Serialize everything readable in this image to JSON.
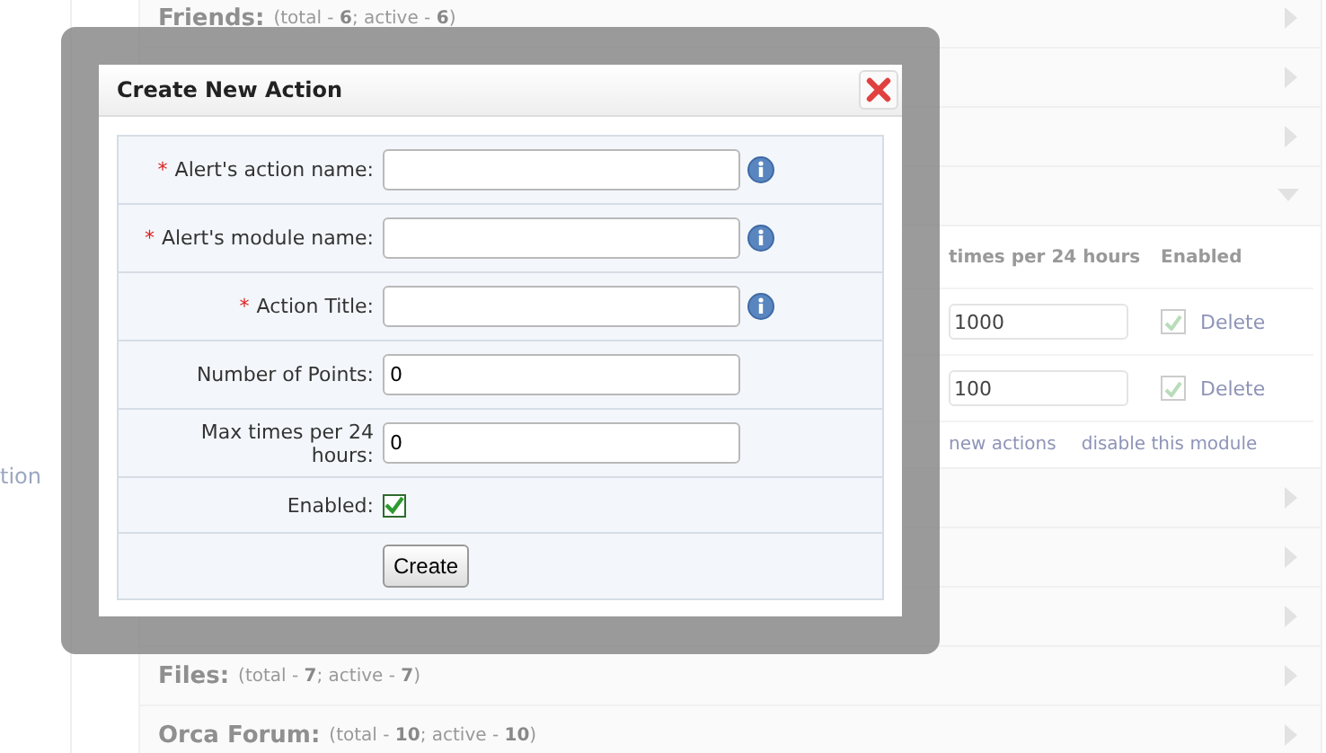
{
  "background": {
    "side_text": "tion",
    "modules": [
      {
        "title": "Friends:",
        "summary": "(total - **6**; active - **6**)",
        "expanded": false
      },
      {
        "expanded": false
      },
      {
        "expanded": false
      },
      {
        "expanded": true,
        "table": {
          "columns": [
            "times per 24 hours",
            "Enabled"
          ],
          "rows": [
            {
              "value": "1000",
              "enabled": true,
              "action": "Delete"
            },
            {
              "value": "100",
              "enabled": true,
              "action": "Delete"
            }
          ],
          "links": [
            "new actions",
            "disable this module"
          ]
        }
      },
      {
        "expanded": false
      },
      {
        "expanded": false
      },
      {
        "expanded": false
      },
      {
        "title": "Files:",
        "summary": "(total - **7**; active - **7**)",
        "expanded": false
      },
      {
        "title": "Orca Forum:",
        "summary": "(total - **10**; active - **10**)",
        "expanded": false
      }
    ]
  },
  "dialog": {
    "title": "Create New Action",
    "fields": [
      {
        "kind": "text",
        "required_mark": "*",
        "label": "Alert's action name:",
        "info": true
      },
      {
        "kind": "text",
        "required_mark": "*",
        "label": "Alert's module name:",
        "info": true
      },
      {
        "kind": "text",
        "required_mark": "*",
        "label": "Action Title:",
        "info": true
      },
      {
        "kind": "text",
        "label": "Number of Points:",
        "value": "0",
        "info": false
      },
      {
        "kind": "text",
        "label": "Max times per 24 hours:",
        "value": "0",
        "info": false
      },
      {
        "kind": "checkbox",
        "label": "Enabled:",
        "checked": true
      }
    ],
    "button": "Create"
  }
}
